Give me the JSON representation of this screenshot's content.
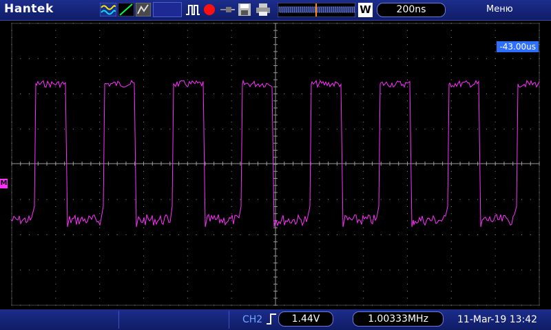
{
  "header": {
    "brand": "Hantek",
    "timebase": "200ns",
    "menu_label": "Меню",
    "mode_letter": "W",
    "toolbar_icons": [
      "math-wave-icon",
      "ramp-icon",
      "persist-icon",
      "pulse-icon",
      "record-icon",
      "probe-icon",
      "save-icon",
      "print-icon"
    ]
  },
  "screen": {
    "trigger_offset": "-43.00us",
    "marker_label": "M",
    "trace_color": "#ff30ff",
    "grid_color": "#9a9a9a",
    "high_level": 1,
    "low_level": 0,
    "periods_shown": 8
  },
  "footer": {
    "channel": "CH2",
    "trigger_level": "1.44V",
    "frequency": "1.00333MHz",
    "datetime": "11-Mar-19 13:42"
  },
  "colors": {
    "bar_bg": "#1c2d8c",
    "accent_blue": "#2f6fff",
    "trace": "#ff30ff"
  }
}
